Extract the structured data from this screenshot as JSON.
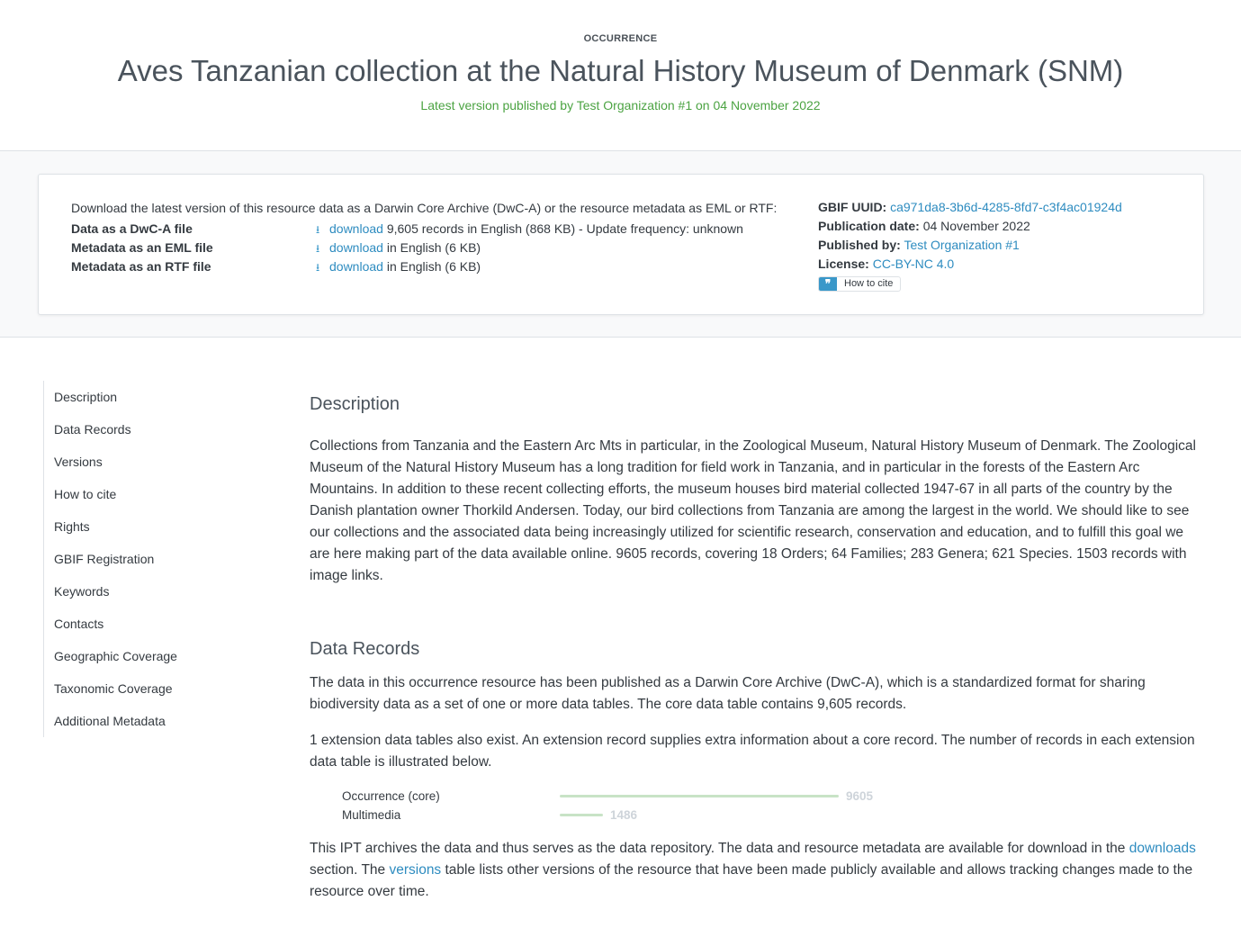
{
  "header": {
    "type_label": "OCCURRENCE",
    "title": "Aves Tanzanian collection at the Natural History Museum of Denmark (SNM)",
    "subtitle": "Latest version published by Test Organization #1 on 04 November 2022"
  },
  "downloads": {
    "intro": "Download the latest version of this resource data as a Darwin Core Archive (DwC-A) or the resource metadata as EML or RTF:",
    "rows": [
      {
        "label": "Data as a DwC-A file",
        "link": "download",
        "detail": "9,605 records in English (868 KB) - Update frequency: unknown"
      },
      {
        "label": "Metadata as an EML file",
        "link": "download",
        "detail": "in English (6 KB)"
      },
      {
        "label": "Metadata as an RTF file",
        "link": "download",
        "detail": "in English (6 KB)"
      }
    ]
  },
  "meta": {
    "uuid_label": "GBIF UUID:",
    "uuid": "ca971da8-3b6d-4285-8fd7-c3f4ac01924d",
    "pubdate_label": "Publication date:",
    "pubdate": "04 November 2022",
    "publisher_label": "Published by:",
    "publisher": "Test Organization #1",
    "license_label": "License:",
    "license": "CC-BY-NC 4.0",
    "cite_button": "How to cite"
  },
  "sidebar": {
    "items": [
      "Description",
      "Data Records",
      "Versions",
      "How to cite",
      "Rights",
      "GBIF Registration",
      "Keywords",
      "Contacts",
      "Geographic Coverage",
      "Taxonomic Coverage",
      "Additional Metadata"
    ]
  },
  "description": {
    "heading": "Description",
    "text": "Collections from Tanzania and the Eastern Arc Mts in particular, in the Zoological Museum, Natural History Museum of Denmark. The Zoological Museum of the Natural History Museum has a long tradition for field work in Tanzania, and in particular in the forests of the Eastern Arc Mountains. In addition to these recent collecting efforts, the museum houses bird material collected 1947-67 in all parts of the country by the Danish plantation owner Thorkild Andersen. Today, our bird collections from Tanzania are among the largest in the world. We should like to see our collections and the associated data being increasingly utilized for scientific research, conservation and education, and to fulfill this goal we are here making part of the data available online. 9605 records, covering 18 Orders; 64 Families; 283 Genera; 621 Species. 1503 records with image links."
  },
  "data_records": {
    "heading": "Data Records",
    "p1": "The data in this occurrence resource has been published as a Darwin Core Archive (DwC-A), which is a standardized format for sharing biodiversity data as a set of one or more data tables. The core data table contains 9,605 records.",
    "p2": "1 extension data tables also exist. An extension record supplies extra information about a core record. The number of records in each extension data table is illustrated below.",
    "p3_a": "This IPT archives the data and thus serves as the data repository. The data and resource metadata are available for download in the ",
    "p3_link1": "downloads",
    "p3_b": " section. The ",
    "p3_link2": "versions",
    "p3_c": " table lists other versions of the resource that have been made publicly available and allows tracking changes made to the resource over time."
  },
  "chart_data": {
    "type": "bar",
    "categories": [
      "Occurrence (core)",
      "Multimedia"
    ],
    "values": [
      9605,
      1486
    ],
    "colors": {
      "bar": "#c8e3c6",
      "value_text": "#ced4da"
    }
  }
}
